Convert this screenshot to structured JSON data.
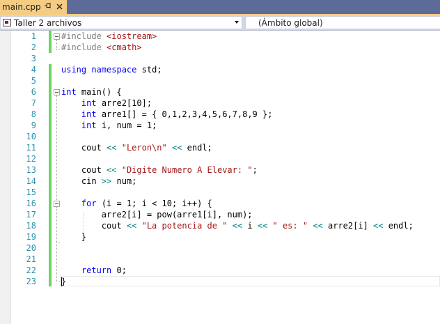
{
  "tab": {
    "title": "main.cpp",
    "pin_icon": "pin-icon",
    "close_icon": "close-icon"
  },
  "navbar": {
    "project": "Taller 2 archivos",
    "scope": "(Ámbito global)"
  },
  "line_numbers": [
    "1",
    "2",
    "3",
    "4",
    "5",
    "6",
    "7",
    "8",
    "9",
    "10",
    "11",
    "12",
    "13",
    "14",
    "15",
    "16",
    "17",
    "18",
    "19",
    "20",
    "21",
    "22",
    "23"
  ],
  "code": [
    [
      {
        "t": "pp",
        "v": "#include "
      },
      {
        "t": "inc",
        "v": "<iostream>"
      }
    ],
    [
      {
        "t": "pp",
        "v": "#include "
      },
      {
        "t": "inc",
        "v": "<cmath>"
      }
    ],
    [],
    [
      {
        "t": "kw",
        "v": "using"
      },
      {
        "t": "plain",
        "v": " "
      },
      {
        "t": "kw",
        "v": "namespace"
      },
      {
        "t": "plain",
        "v": " std;"
      }
    ],
    [],
    [
      {
        "t": "kw",
        "v": "int"
      },
      {
        "t": "plain",
        "v": " main() {"
      }
    ],
    [
      {
        "t": "plain",
        "v": "    "
      },
      {
        "t": "kw",
        "v": "int"
      },
      {
        "t": "plain",
        "v": " arre2[10];"
      }
    ],
    [
      {
        "t": "plain",
        "v": "    "
      },
      {
        "t": "kw",
        "v": "int"
      },
      {
        "t": "plain",
        "v": " arre1[] = { 0,1,2,3,4,5,6,7,8,9 };"
      }
    ],
    [
      {
        "t": "plain",
        "v": "    "
      },
      {
        "t": "kw",
        "v": "int"
      },
      {
        "t": "plain",
        "v": " i, num = 1;"
      }
    ],
    [],
    [
      {
        "t": "plain",
        "v": "    cout "
      },
      {
        "t": "op",
        "v": "<<"
      },
      {
        "t": "plain",
        "v": " "
      },
      {
        "t": "str",
        "v": "\"Leron\\n\""
      },
      {
        "t": "plain",
        "v": " "
      },
      {
        "t": "op",
        "v": "<<"
      },
      {
        "t": "plain",
        "v": " endl;"
      }
    ],
    [],
    [
      {
        "t": "plain",
        "v": "    cout "
      },
      {
        "t": "op",
        "v": "<<"
      },
      {
        "t": "plain",
        "v": " "
      },
      {
        "t": "str",
        "v": "\"Digite Numero A Elevar: \""
      },
      {
        "t": "plain",
        "v": ";"
      }
    ],
    [
      {
        "t": "plain",
        "v": "    cin "
      },
      {
        "t": "op",
        "v": ">>"
      },
      {
        "t": "plain",
        "v": " num;"
      }
    ],
    [],
    [
      {
        "t": "plain",
        "v": "    "
      },
      {
        "t": "kw",
        "v": "for"
      },
      {
        "t": "plain",
        "v": " (i = 1; i < 10; i++) {"
      }
    ],
    [
      {
        "t": "plain",
        "v": "        arre2[i] = pow(arre1[i], num);"
      }
    ],
    [
      {
        "t": "plain",
        "v": "        cout "
      },
      {
        "t": "op",
        "v": "<<"
      },
      {
        "t": "plain",
        "v": " "
      },
      {
        "t": "str",
        "v": "\"La potencia de \""
      },
      {
        "t": "plain",
        "v": " "
      },
      {
        "t": "op",
        "v": "<<"
      },
      {
        "t": "plain",
        "v": " i "
      },
      {
        "t": "op",
        "v": "<<"
      },
      {
        "t": "plain",
        "v": " "
      },
      {
        "t": "str",
        "v": "\" es: \""
      },
      {
        "t": "plain",
        "v": " "
      },
      {
        "t": "op",
        "v": "<<"
      },
      {
        "t": "plain",
        "v": " arre2[i] "
      },
      {
        "t": "op",
        "v": "<<"
      },
      {
        "t": "plain",
        "v": " endl;"
      }
    ],
    [
      {
        "t": "plain",
        "v": "    }"
      }
    ],
    [],
    [],
    [
      {
        "t": "plain",
        "v": "    "
      },
      {
        "t": "kw",
        "v": "return"
      },
      {
        "t": "plain",
        "v": " 0;"
      }
    ],
    [
      {
        "t": "plain",
        "v": "}"
      }
    ]
  ],
  "colors": {
    "tab_active": "#f5cc84",
    "tab_strip": "#5d6b99",
    "navbar": "#cfd6e5",
    "line_number": "#2b91af",
    "keyword": "#0000ff",
    "string": "#a31515",
    "preprocessor": "#808080",
    "operator": "#008080",
    "change_bar": "#6cd460"
  }
}
